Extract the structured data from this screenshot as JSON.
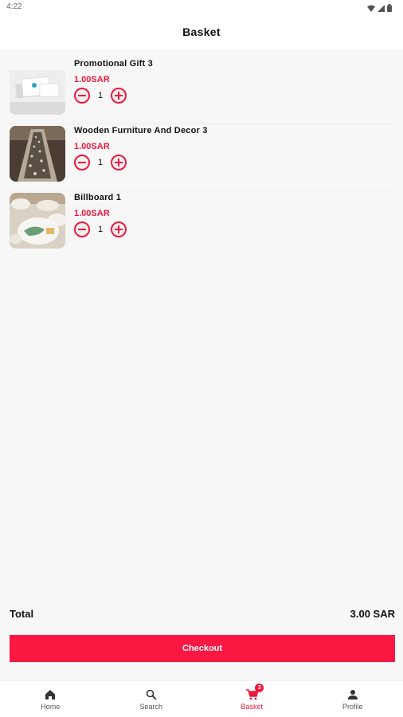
{
  "status_bar": {
    "time": "4:22"
  },
  "header": {
    "title": "Basket"
  },
  "items": [
    {
      "name": "Promotional Gift 3",
      "price": "1.00SAR",
      "quantity": "1"
    },
    {
      "name": "Wooden Furniture And Decor 3",
      "price": "1.00SAR",
      "quantity": "1"
    },
    {
      "name": "Billboard 1",
      "price": "1.00SAR",
      "quantity": "1"
    }
  ],
  "summary": {
    "total_label": "Total",
    "total_value": "3.00 SAR"
  },
  "checkout": {
    "label": "Checkout"
  },
  "nav": {
    "items": [
      {
        "label": "Home",
        "icon": "home-icon"
      },
      {
        "label": "Search",
        "icon": "search-icon"
      },
      {
        "label": "Basket",
        "icon": "cart-icon",
        "badge": "3",
        "active": true
      },
      {
        "label": "Profile",
        "icon": "person-icon"
      }
    ]
  },
  "colors": {
    "accent": "#f0183d",
    "checkout": "#fd1743",
    "background": "#f7f7f7"
  }
}
